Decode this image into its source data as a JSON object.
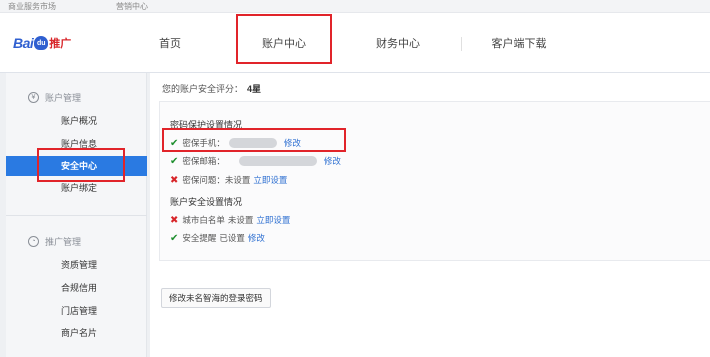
{
  "topbar": {
    "link1": "商业服务市场",
    "link2": "营销中心"
  },
  "logo": {
    "bai": "Bai",
    "du": "du",
    "tuiguang": "推广"
  },
  "nav": {
    "home": "首页",
    "account_center": "账户中心",
    "finance_center": "财务中心",
    "client_download": "客户端下载"
  },
  "sidebar": {
    "group1_title": "账户管理",
    "group1_items": [
      "账户概况",
      "账户信息",
      "安全中心",
      "账户绑定"
    ],
    "group2_title": "推广管理",
    "group2_items": [
      "资质管理",
      "合规信用",
      "门店管理",
      "商户名片"
    ]
  },
  "main": {
    "score_label": "您的账户安全评分：",
    "score_value": "4星",
    "password_section_title": "密码保护设置情况",
    "phone_label": "密保手机：",
    "phone_modify": "修改",
    "email_label": "密保邮箱：",
    "email_modify": "修改",
    "question_label": "密保问题：",
    "question_status": "未设置",
    "question_action": "立即设置",
    "account_section_title": "账户安全设置情况",
    "whitelist_label": "城市白名单",
    "whitelist_status": "未设置",
    "whitelist_action": "立即设置",
    "reminder_label": "安全提醒",
    "reminder_status": "已设置",
    "reminder_modify": "修改",
    "change_password_button": "修改未名智海的登录密码"
  },
  "colors": {
    "active_blue": "#2a7ae2",
    "highlight_red": "#e1242a",
    "link_blue": "#2d6fd1",
    "ok_green": "#1f8f2f",
    "warn_red": "#d8262a"
  }
}
